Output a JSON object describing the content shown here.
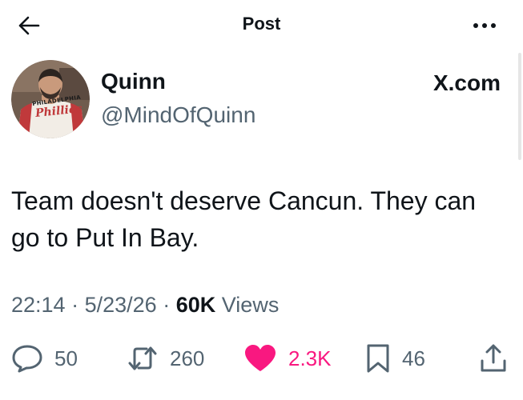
{
  "topbar": {
    "title": "Post",
    "back_icon": "arrow-left-icon",
    "more_icon": "ellipsis-icon"
  },
  "author": {
    "display_name": "Quinn",
    "handle": "@MindOfQuinn",
    "avatar_text": "PHILADELPHIA",
    "avatar_logo": "Phillies",
    "source": "X.com"
  },
  "post": {
    "text": "Team doesn't deserve Cancun. They can go to Put In Bay."
  },
  "meta": {
    "time": "22:14",
    "separator": "·",
    "date": "5/23/26",
    "views_count": "60K",
    "views_label": "Views"
  },
  "actions": {
    "replies": "50",
    "reposts": "260",
    "likes": "2.3K",
    "bookmarks": "46"
  },
  "colors": {
    "text": "#0f1419",
    "secondary": "#536471",
    "like": "#f91880"
  }
}
